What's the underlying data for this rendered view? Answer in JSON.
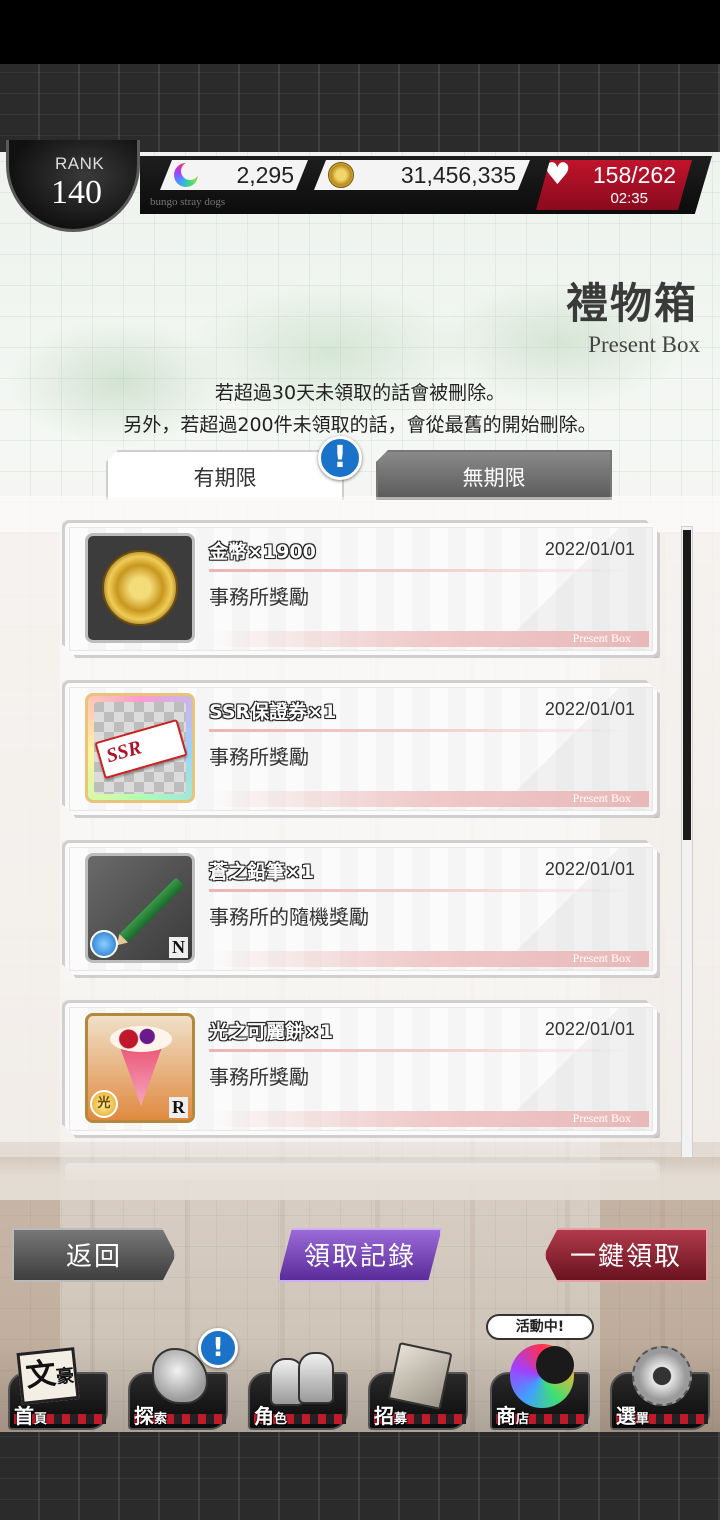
{
  "status": {
    "rank_label": "RANK",
    "rank_value": "140",
    "subtitle": "bungo stray dogs",
    "gems": "2,295",
    "coins": "31,456,335",
    "ap_current": "158",
    "ap_max": "/262",
    "ap_badge": "AP",
    "ap_timer": "02:35"
  },
  "page": {
    "title": "禮物箱",
    "title_en": "Present Box",
    "notice_line1": "若超過30天未領取的話會被刪除。",
    "notice_line2": "另外，若超過200件未領取的話，會從最舊的開始刪除。"
  },
  "tabs": [
    {
      "label": "有期限",
      "active": true
    },
    {
      "label": "無期限",
      "active": false
    }
  ],
  "alert_glyph": "!",
  "items": [
    {
      "name": "金幣×1900",
      "date": "2022/01/01",
      "description": "事務所獎勵",
      "footer": "Present Box",
      "icon": "gold-coin-icon"
    },
    {
      "name": "SSR保證券×1",
      "date": "2022/01/01",
      "description": "事務所獎勵",
      "footer": "Present Box",
      "icon": "ssr-ticket-icon",
      "ticket_text": "SSR"
    },
    {
      "name": "蒼之鉛筆×1",
      "date": "2022/01/01",
      "description": "事務所的隨機獎勵",
      "footer": "Present Box",
      "icon": "green-pencil-icon",
      "rarity": "N"
    },
    {
      "name": "光之可麗餅×1",
      "date": "2022/01/01",
      "description": "事務所獎勵",
      "footer": "Present Box",
      "icon": "crepe-icon",
      "rarity": "R",
      "element": "光"
    }
  ],
  "buttons": {
    "back": "返回",
    "history": "領取記錄",
    "claim_all": "一鍵領取"
  },
  "nav": {
    "event_tag": "活動中!",
    "home_icon_text": "文",
    "home_icon_text2": "豪",
    "items": [
      {
        "label": "首",
        "label_small": "頁"
      },
      {
        "label": "探",
        "label_small": "索"
      },
      {
        "label": "角",
        "label_small": "色"
      },
      {
        "label": "招",
        "label_small": "募"
      },
      {
        "label": "商",
        "label_small": "店"
      },
      {
        "label": "選",
        "label_small": "單"
      }
    ]
  }
}
